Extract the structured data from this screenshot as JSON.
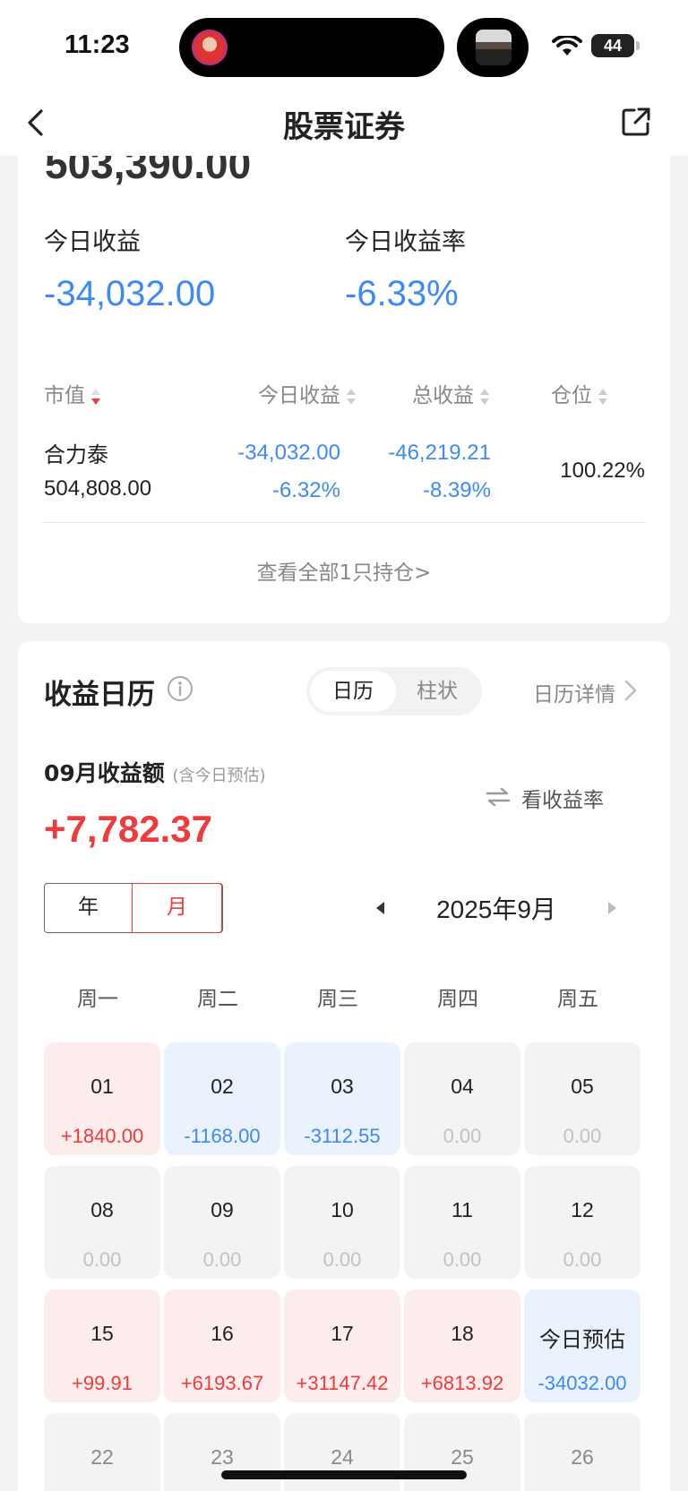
{
  "status_bar": {
    "time": "11:23",
    "battery": "44"
  },
  "nav": {
    "title": "股票证券"
  },
  "summary": {
    "total_value": "503,390.00",
    "today_profit_label": "今日收益",
    "today_profit": "-34,032.00",
    "today_rate_label": "今日收益率",
    "today_rate": "-6.33%"
  },
  "holdings": {
    "headers": [
      "市值",
      "今日收益",
      "总收益",
      "仓位"
    ],
    "row": {
      "name": "合力泰",
      "market_value": "504,808.00",
      "today_profit": "-34,032.00",
      "today_rate": "-6.32%",
      "total_profit": "-46,219.21",
      "total_rate": "-8.39%",
      "position": "100.22%"
    },
    "view_all": "查看全部1只持仓>"
  },
  "calendar_section": {
    "title": "收益日历",
    "toggle": [
      "日历",
      "柱状"
    ],
    "detail_link": "日历详情",
    "month_label": "09月收益额",
    "month_note": "(含今日预估)",
    "see_rate": "看收益率",
    "month_total": "+7,782.37",
    "segments": [
      "年",
      "月"
    ],
    "year_month": "2025年9月",
    "weekdays": [
      "周一",
      "周二",
      "周三",
      "周四",
      "周五"
    ],
    "colors": {
      "profit": "#ee3b3b",
      "loss": "#3d8af7"
    },
    "weeks": [
      [
        {
          "day": "01",
          "value": "+1840.00",
          "tone": "up"
        },
        {
          "day": "02",
          "value": "-1168.00",
          "tone": "down"
        },
        {
          "day": "03",
          "value": "-3112.55",
          "tone": "down"
        },
        {
          "day": "04",
          "value": "0.00",
          "tone": "flat"
        },
        {
          "day": "05",
          "value": "0.00",
          "tone": "flat"
        }
      ],
      [
        {
          "day": "08",
          "value": "0.00",
          "tone": "flat"
        },
        {
          "day": "09",
          "value": "0.00",
          "tone": "flat"
        },
        {
          "day": "10",
          "value": "0.00",
          "tone": "flat"
        },
        {
          "day": "11",
          "value": "0.00",
          "tone": "flat"
        },
        {
          "day": "12",
          "value": "0.00",
          "tone": "flat"
        }
      ],
      [
        {
          "day": "15",
          "value": "+99.91",
          "tone": "up"
        },
        {
          "day": "16",
          "value": "+6193.67",
          "tone": "up"
        },
        {
          "day": "17",
          "value": "+31147.42",
          "tone": "up"
        },
        {
          "day": "18",
          "value": "+6813.92",
          "tone": "up"
        },
        {
          "day": "今日预估",
          "value": "-34032.00",
          "tone": "down"
        }
      ],
      [
        {
          "day": "22",
          "value": "",
          "tone": "future"
        },
        {
          "day": "23",
          "value": "",
          "tone": "future"
        },
        {
          "day": "24",
          "value": "",
          "tone": "future"
        },
        {
          "day": "25",
          "value": "",
          "tone": "future"
        },
        {
          "day": "26",
          "value": "",
          "tone": "future"
        }
      ]
    ]
  }
}
